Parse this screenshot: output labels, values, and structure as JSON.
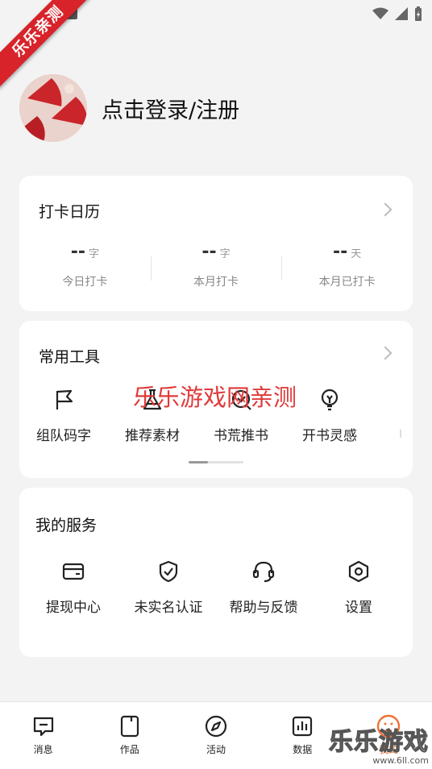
{
  "watermark_ribbon": "乐乐亲测",
  "profile": {
    "login_text": "点击登录/注册"
  },
  "calendar": {
    "title": "打卡日历",
    "stats": [
      {
        "value": "--",
        "unit": "字",
        "label": "今日打卡"
      },
      {
        "value": "--",
        "unit": "字",
        "label": "本月打卡"
      },
      {
        "value": "--",
        "unit": "天",
        "label": "本月已打卡"
      }
    ]
  },
  "tools": {
    "title": "常用工具",
    "items": [
      {
        "label": "组队码字",
        "icon": "flag-icon"
      },
      {
        "label": "推荐素材",
        "icon": "flask-icon"
      },
      {
        "label": "书荒推书",
        "icon": "book-search-icon"
      },
      {
        "label": "开书灵感",
        "icon": "lightbulb-icon"
      }
    ]
  },
  "overlay_watermark": "乐乐游戏网亲测",
  "services": {
    "title": "我的服务",
    "items": [
      {
        "label": "提现中心",
        "icon": "wallet-icon"
      },
      {
        "label": "未实名认证",
        "icon": "shield-check-icon"
      },
      {
        "label": "帮助与反馈",
        "icon": "headset-icon"
      },
      {
        "label": "设置",
        "icon": "settings-hexagon-icon"
      }
    ]
  },
  "bottom_nav": [
    {
      "label": "消息",
      "icon": "message-icon"
    },
    {
      "label": "作品",
      "icon": "works-icon"
    },
    {
      "label": "活动",
      "icon": "compass-icon"
    },
    {
      "label": "数据",
      "icon": "chart-icon"
    },
    {
      "label": "我的",
      "icon": "face-icon",
      "active": true
    }
  ],
  "corner_watermark": {
    "big": "乐乐游戏",
    "small": "www.6ll.com"
  },
  "colors": {
    "accent": "#f07033",
    "ribbon": "#d8232a",
    "watermark": "#e03a3a"
  }
}
